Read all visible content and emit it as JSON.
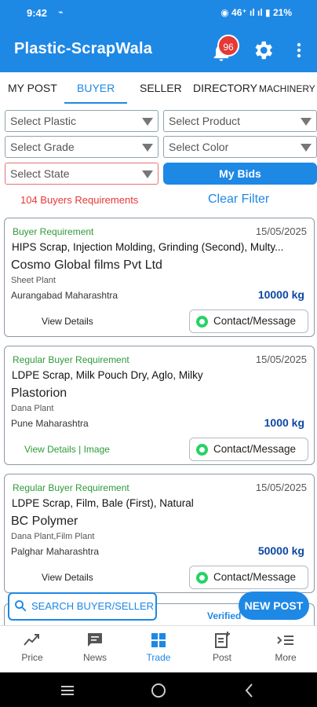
{
  "status_bar": {
    "time": "9:42",
    "left_icons": "⌁",
    "right": "◉ 46⁺ ıl ıl ▮ 21%"
  },
  "app_bar": {
    "title": "Plastic-ScrapWala",
    "notification_count": "96"
  },
  "tabs": [
    {
      "label": "MY POST",
      "active": false
    },
    {
      "label": "BUYER",
      "active": true
    },
    {
      "label": "SELLER",
      "active": false
    },
    {
      "label": "DIRECTORY",
      "active": false
    },
    {
      "label": "MACHINERY",
      "active": false
    }
  ],
  "filters": {
    "plastic": "Select Plastic",
    "product": "Select Product",
    "grade": "Select Grade",
    "color": "Select Color",
    "state": "Select State",
    "my_bids": "My Bids"
  },
  "summary": {
    "count_text": "104 Buyers Requirements",
    "clear_filter": "Clear Filter"
  },
  "cards": [
    {
      "type": "Buyer Requirement",
      "date": "15/05/2025",
      "product": "HIPS Scrap, Injection Molding, Grinding (Second), Multy...",
      "company": "Cosmo Global films Pvt Ltd",
      "plant": "Sheet Plant",
      "location": "Aurangabad Maharashtra",
      "quantity": "10000 kg",
      "details": "View Details",
      "contact": "Contact/Message"
    },
    {
      "type": "Regular Buyer Requirement",
      "date": "15/05/2025",
      "product": "LDPE Scrap, Milk Pouch Dry, Aglo, Milky",
      "company": "Plastorion",
      "plant": "Dana Plant",
      "location": "Pune Maharashtra",
      "quantity": "1000 kg",
      "details": "View Details | Image",
      "contact": "Contact/Message"
    },
    {
      "type": "Regular Buyer Requirement",
      "date": "15/05/2025",
      "product": "LDPE Scrap, Film, Bale (First), Natural",
      "company": "BC Polymer",
      "plant": "Dana Plant,Film Plant",
      "location": "Palghar Maharashtra",
      "quantity": "50000 kg",
      "details": "View Details",
      "contact": "Contact/Message"
    }
  ],
  "partial_card": {
    "verified": "Verified"
  },
  "search_button": "SEARCH BUYER/SELLER",
  "new_post_button": "NEW POST",
  "bottom_nav": [
    {
      "label": "Price",
      "icon": "price-trend-icon"
    },
    {
      "label": "News",
      "icon": "news-chat-icon"
    },
    {
      "label": "Trade",
      "icon": "grid-icon",
      "active": true
    },
    {
      "label": "Post",
      "icon": "post-add-icon"
    },
    {
      "label": "More",
      "icon": "more-list-icon"
    }
  ],
  "colors": {
    "primary": "#1e88e5",
    "green": "#2e9a3a",
    "red": "#e53935",
    "quantity": "#0d47a1"
  }
}
